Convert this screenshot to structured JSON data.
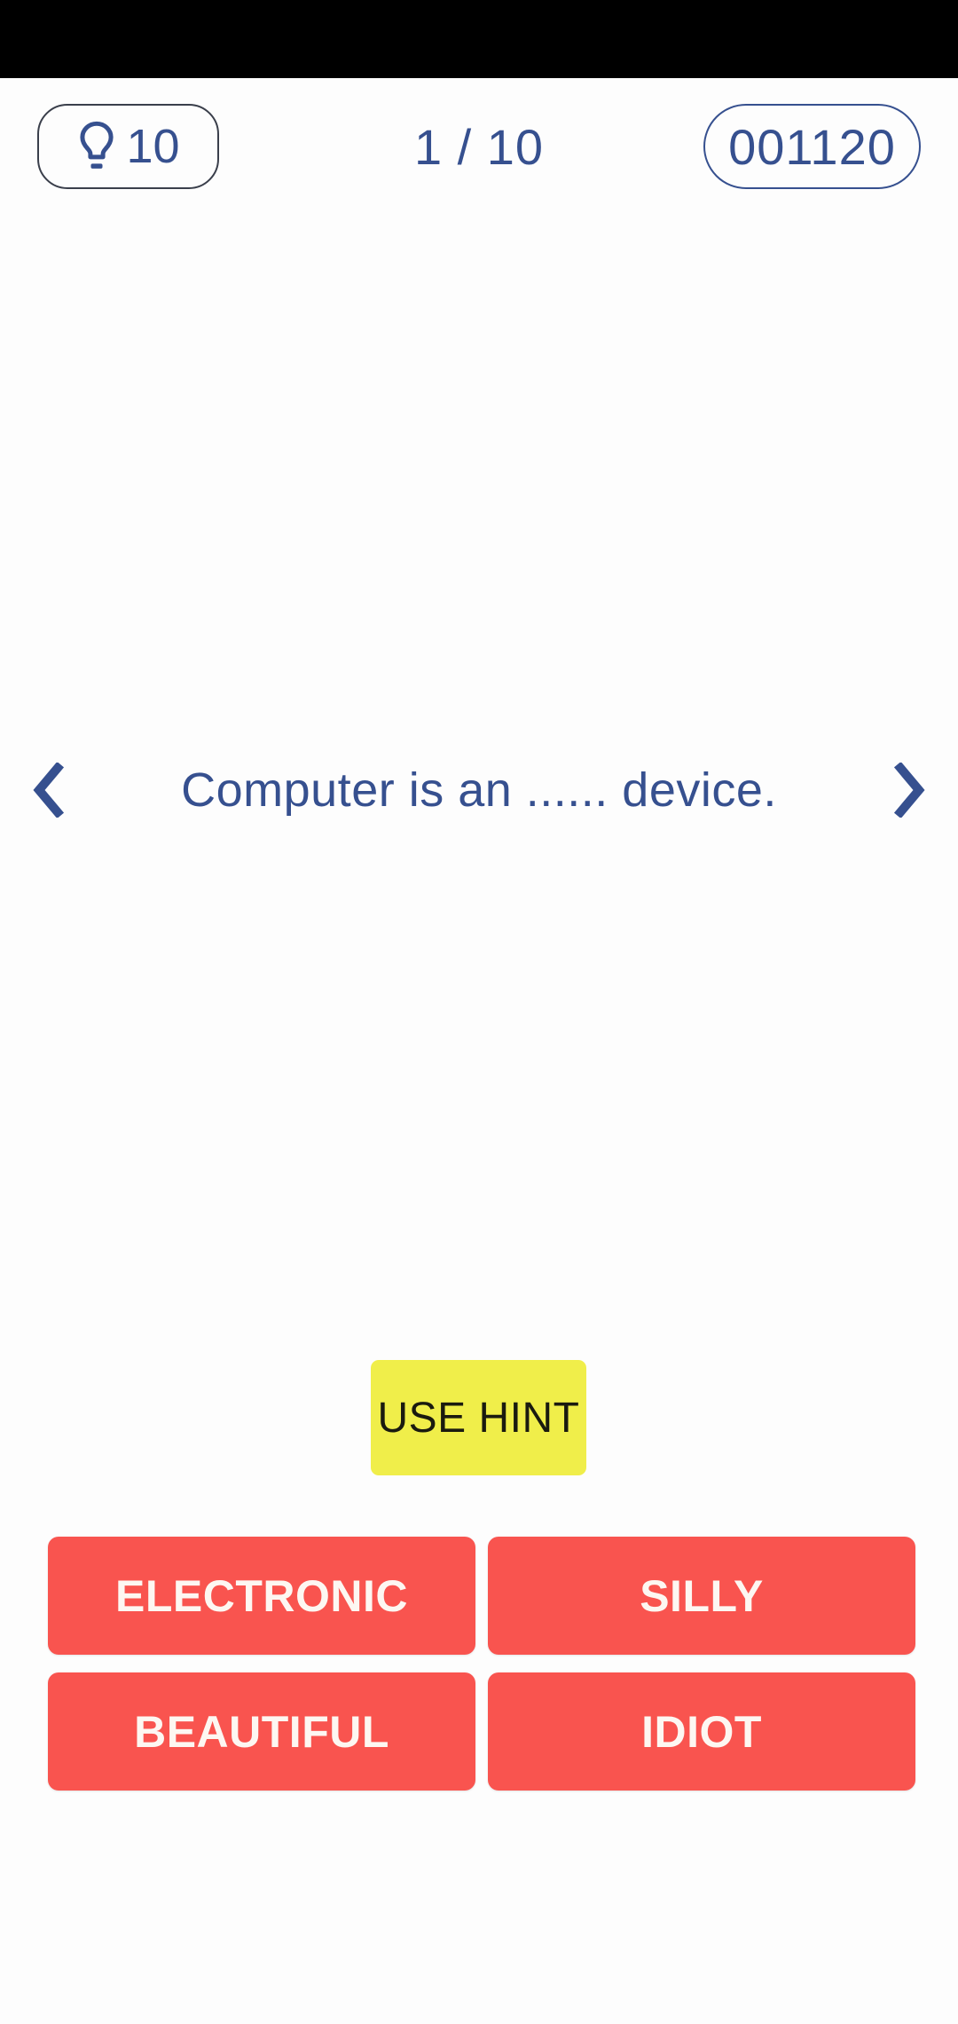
{
  "app": {
    "background_color": "#fdfdfd",
    "accent_blue": "#36508f",
    "answer_red": "#f9544f",
    "hint_yellow": "#f0ee4a"
  },
  "status_bar": {
    "color": "#000000"
  },
  "hud": {
    "hint_icon": "lightbulb-icon",
    "hint_count": "10",
    "question_counter": "1 / 10",
    "score": "001120"
  },
  "question": {
    "prev_icon": "chevron-left-icon",
    "next_icon": "chevron-right-icon",
    "text": "Computer is an ...... device."
  },
  "hint_button": {
    "label": "USE HINT"
  },
  "answers": [
    {
      "label": "ELECTRONIC"
    },
    {
      "label": "SILLY"
    },
    {
      "label": "BEAUTIFUL"
    },
    {
      "label": "IDIOT"
    }
  ]
}
